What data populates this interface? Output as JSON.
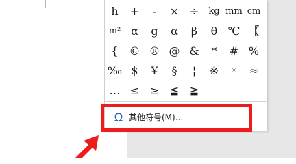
{
  "symbol_panel": {
    "rows": [
      [
        "h",
        "+",
        "-",
        "×",
        "÷",
        "kg",
        "mm",
        "cm"
      ],
      [
        "m²",
        "α",
        "g",
        "α",
        "β",
        "θ",
        "℃",
        "〖"
      ],
      [
        "{",
        "©",
        "®",
        "@",
        "&",
        "*",
        "#",
        "%"
      ],
      [
        "‰",
        "$",
        "¥",
        "§",
        "¦",
        "※",
        "◎",
        "≈"
      ],
      [
        "…",
        "≤",
        "≥",
        "≦",
        "≧",
        "",
        "",
        ""
      ]
    ]
  },
  "more_symbols": {
    "icon": "omega-icon",
    "label": "其他符号(M)..."
  },
  "annotation": {
    "highlight_color": "#ee1c1c",
    "arrow_color": "#ee1c1c"
  }
}
